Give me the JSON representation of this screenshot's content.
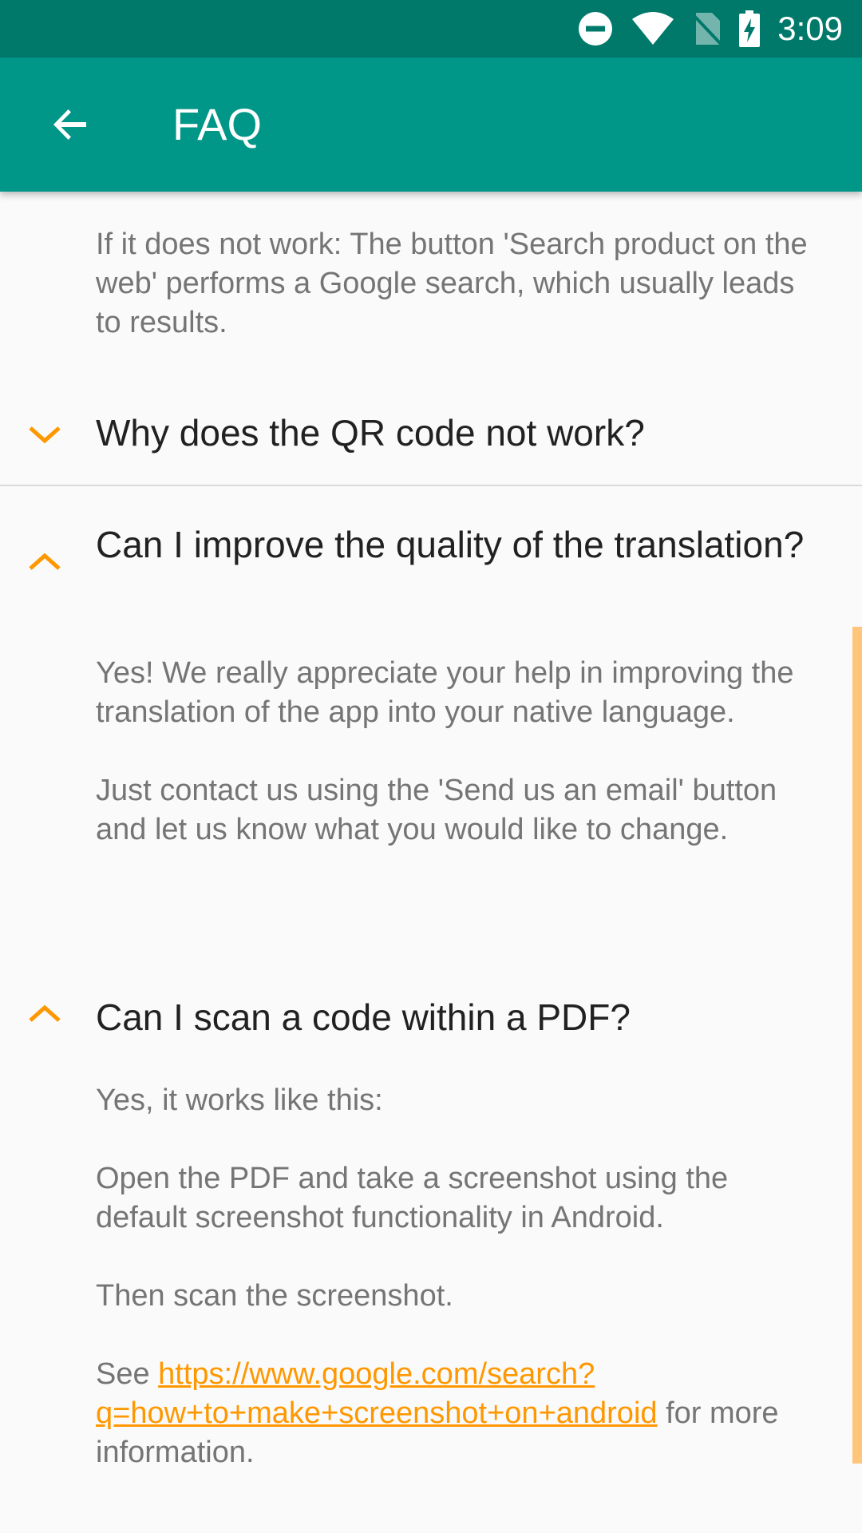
{
  "status_bar": {
    "time": "3:09",
    "icons": [
      "do-not-disturb-icon",
      "wifi-icon",
      "no-sim-icon",
      "battery-charging-icon"
    ]
  },
  "app_bar": {
    "title": "FAQ",
    "back_icon": "arrow-back-icon"
  },
  "colors": {
    "status_bar": "#00796b",
    "app_bar": "#009688",
    "accent": "#ff9800",
    "background": "#fafafa",
    "question_text": "#212121",
    "answer_text": "#757575"
  },
  "faq": {
    "item0": {
      "answer": "If it does not work: The button 'Search product on the web' performs a Google search, which usually leads to results."
    },
    "item1": {
      "question": "Why does the QR code not work?",
      "expanded": false
    },
    "item2": {
      "question": "Can I improve the quality of the translation?",
      "expanded": true,
      "answer_p1": "Yes! We really appreciate your help in improving the translation of the app into your native language.",
      "answer_p2": "Just contact us using the 'Send us an email' button and let us know what you would like to change."
    },
    "item3": {
      "question": "Can I scan a code within a PDF?",
      "expanded": true,
      "answer_p1": "Yes, it works like this:",
      "answer_p2": "Open the PDF and take a screenshot using the default screenshot functionality in Android.",
      "answer_p3": "Then scan the screenshot.",
      "answer_p4_prefix": "See ",
      "answer_p4_link": "https://www.google.com/search?q=how+to+make+screenshot+on+android",
      "answer_p4_suffix": " for more information."
    }
  }
}
